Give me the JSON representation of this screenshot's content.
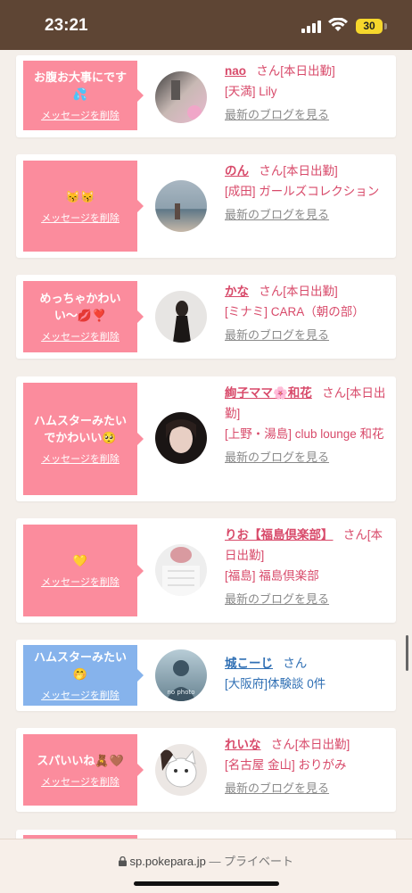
{
  "status": {
    "time": "23:21",
    "battery": "30"
  },
  "browser": {
    "domain": "sp.pokepara.jp",
    "suffix": " — プライベート"
  },
  "common": {
    "delete_label": "メッセージを削除",
    "blog_label": "最新のブログを見る",
    "san": "さん"
  },
  "cards": [
    {
      "message": "お腹お大事にです💦",
      "name": "nao",
      "status": "[本日出勤]",
      "shop": "[天満] Lily"
    },
    {
      "message": "😽😽",
      "name": "のん",
      "status": "[本日出勤]",
      "shop": "[成田] ガールズコレクション"
    },
    {
      "message": "めっちゃかわいい〜💋❣️",
      "name": "かな",
      "status": "[本日出勤]",
      "shop": "[ミナミ] CARA（朝の部）"
    },
    {
      "message": "ハムスターみたいでかわいい🥺",
      "name": "絢子ママ🌸和花",
      "status": "[本日出勤]",
      "shop": "[上野・湯島] club lounge 和花"
    },
    {
      "message": "💛",
      "name": "りお【福島倶楽部】",
      "status": "[本日出勤]",
      "shop": "[福島] 福島倶楽部"
    },
    {
      "message": "ハムスターみたい🤭",
      "name": "城こーじ",
      "status": "",
      "shop": "[大阪府]体験談 0件",
      "avatar_text": "no photo"
    },
    {
      "message": "スパいいね🧸🤎",
      "name": "れいな",
      "status": "[本日出勤]",
      "shop": "[名古屋 金山] おりがみ"
    }
  ]
}
